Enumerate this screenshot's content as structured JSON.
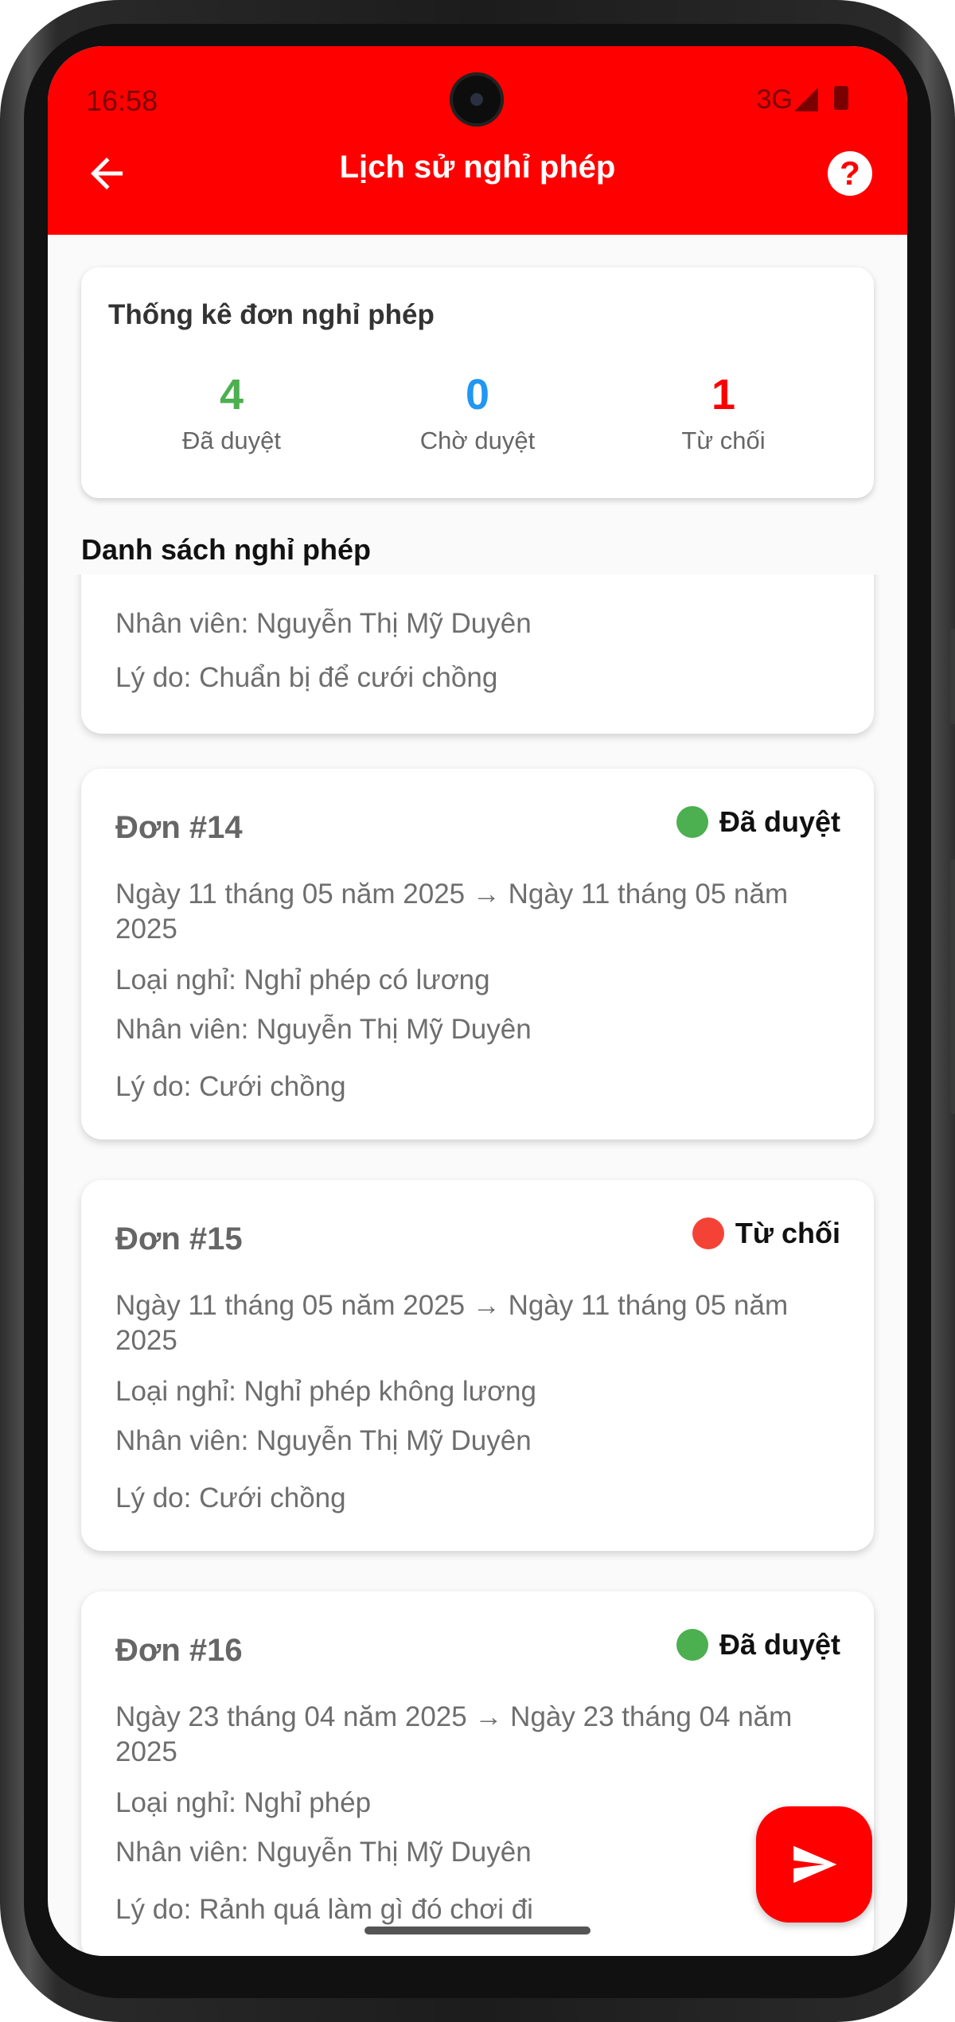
{
  "status_bar": {
    "time": "16:58",
    "network": "3G"
  },
  "header": {
    "title": "Lịch sử nghỉ phép",
    "back_icon": "arrow-left-icon",
    "help_icon": "help-circle-icon"
  },
  "stats": {
    "title": "Thống kê đơn nghỉ phép",
    "approved": {
      "count": "4",
      "label": "Đã duyệt",
      "color": "#4caf50"
    },
    "pending": {
      "count": "0",
      "label": "Chờ duyệt",
      "color": "#2196f3"
    },
    "rejected": {
      "count": "1",
      "label": "Từ chối",
      "color": "#ff0000"
    }
  },
  "list": {
    "title": "Danh sách nghỉ phép",
    "partial": {
      "employee": "Nhân viên: Nguyễn Thị Mỹ Duyên",
      "reason": "Lý do: Chuẩn bị để cưới chồng"
    },
    "items": [
      {
        "id": "Đơn #14",
        "status": "Đã duyệt",
        "status_color": "#4caf50",
        "dates": "Ngày 11 tháng 05 năm 2025 → Ngày 11 tháng 05 năm 2025",
        "type": "Loại nghỉ: Nghỉ phép có lương",
        "employee": "Nhân viên: Nguyễn Thị Mỹ Duyên",
        "reason": "Lý do: Cưới chồng"
      },
      {
        "id": "Đơn #15",
        "status": "Từ chối",
        "status_color": "#f44336",
        "dates": "Ngày 11 tháng 05 năm 2025 → Ngày 11 tháng 05 năm 2025",
        "type": "Loại nghỉ: Nghỉ phép không lương",
        "employee": "Nhân viên: Nguyễn Thị Mỹ Duyên",
        "reason": "Lý do: Cưới chồng"
      },
      {
        "id": "Đơn #16",
        "status": "Đã duyệt",
        "status_color": "#4caf50",
        "dates": "Ngày 23 tháng 04 năm 2025 → Ngày 23 tháng 04 năm 2025",
        "type": "Loại nghỉ: Nghỉ phép",
        "employee": "Nhân viên: Nguyễn Thị Mỹ Duyên",
        "reason": "Lý do: Rảnh quá làm gì đó chơi đi"
      }
    ]
  },
  "fab": {
    "icon": "send-icon"
  },
  "colors": {
    "brand": "#ff0000"
  }
}
